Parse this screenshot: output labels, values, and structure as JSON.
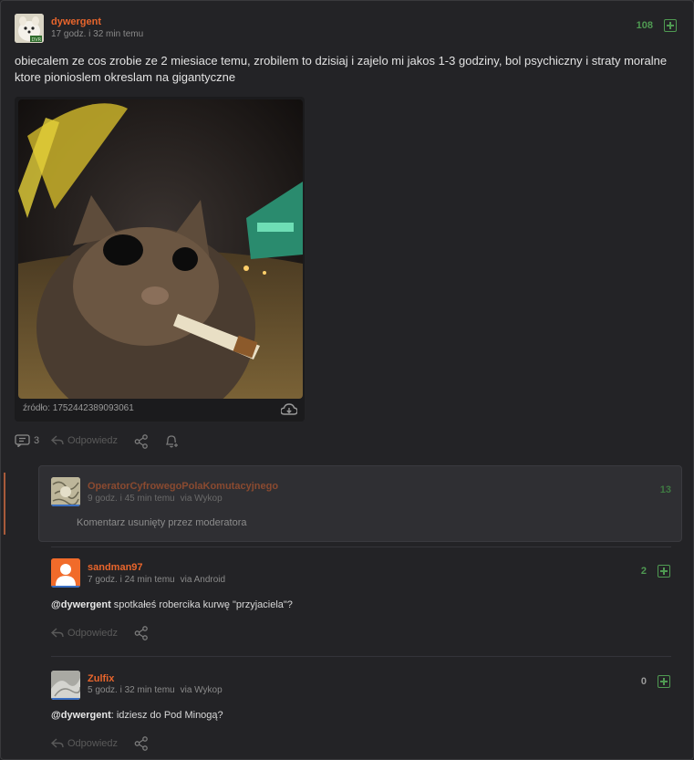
{
  "post": {
    "author": "dywergent",
    "time": "17 godz. i 32 min temu",
    "votes": "108",
    "text": "obiecalem ze cos zrobie ze 2 miesiace temu, zrobilem to dzisiaj i zajelo mi jakos 1-3 godziny, bol psychiczny i straty moralne ktore pionioslem okreslam na gigantyczne",
    "image_source": "źródło: 1752442389093061",
    "comment_count": "3",
    "reply_label": "Odpowiedz",
    "colors": {
      "author": "#e8652c",
      "vote": "#4f9a52"
    }
  },
  "comments": [
    {
      "author": "OperatorCyfrowegoPolaKomutacyjnego",
      "time": "9 godz. i 45 min temu",
      "via": "via Wykop",
      "votes": "13",
      "text": "Komentarz usunięty przez moderatora"
    },
    {
      "author": "sandman97",
      "time": "7 godz. i 24 min temu",
      "via": "via Android",
      "votes": "2",
      "mention": "@dywergent",
      "text": " spotkałeś robercika kurwę \"przyjaciela\"?",
      "reply_label": "Odpowiedz"
    },
    {
      "author": "Zulfix",
      "time": "5 godz. i 32 min temu",
      "via": "via Wykop",
      "votes": "0",
      "mention": "@dywergent",
      "text": ": idziesz do Pod Minogą?",
      "reply_label": "Odpowiedz"
    }
  ]
}
